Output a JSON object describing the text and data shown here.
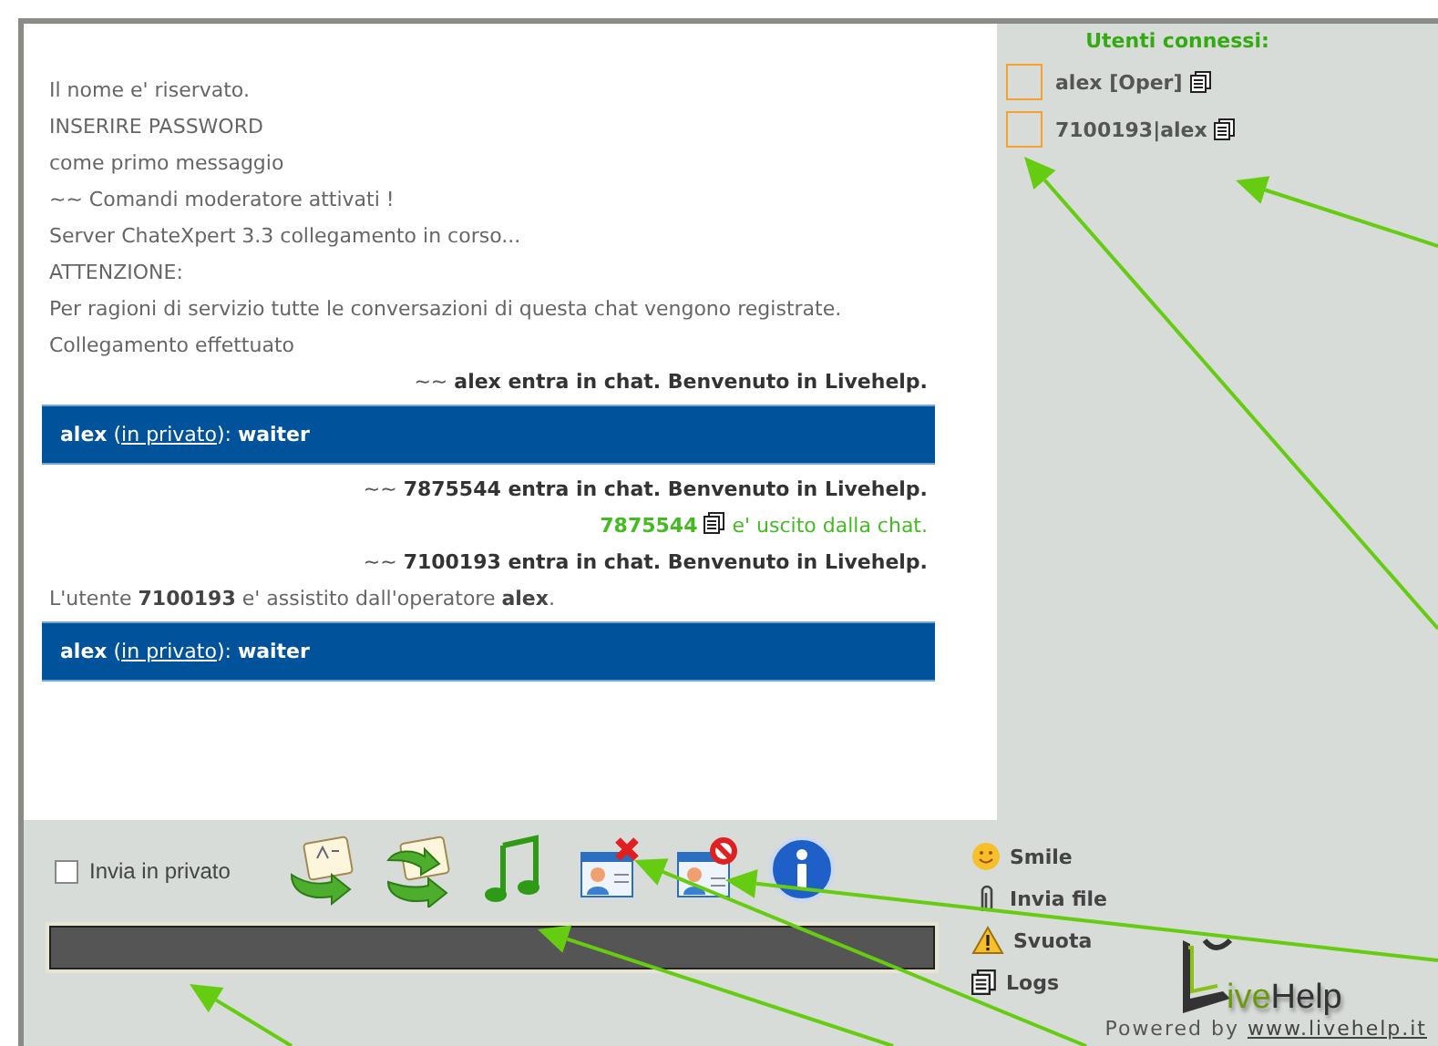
{
  "chat": {
    "messages": [
      {
        "kind": "system",
        "text": "Il nome e' riservato."
      },
      {
        "kind": "system",
        "text": "INSERIRE PASSWORD"
      },
      {
        "kind": "system",
        "text": "come primo messaggio"
      },
      {
        "kind": "system",
        "text": "~~ Comandi moderatore attivati !"
      },
      {
        "kind": "system",
        "text": "Server ChateXpert 3.3 collegamento in corso..."
      },
      {
        "kind": "system",
        "text": "ATTENZIONE:"
      },
      {
        "kind": "system",
        "text": "Per ragioni di servizio tutte le conversazioni di questa chat vengono registrate."
      },
      {
        "kind": "system",
        "text": "Collegamento effettuato"
      },
      {
        "kind": "join",
        "text": "~~ **alex entra in chat. Benvenuto in Livehelp.**"
      },
      {
        "kind": "private",
        "sender": "alex",
        "open": "(",
        "link": "in privato",
        "close": "):",
        "text": "waiter"
      },
      {
        "kind": "join",
        "text": "~~ **7875544 entra in chat. Benvenuto in Livehelp.**"
      },
      {
        "kind": "leave",
        "nick": "7875544",
        "text": "e' uscito dalla chat."
      },
      {
        "kind": "join",
        "text": "~~ **7100193 entra in chat. Benvenuto in Livehelp.**"
      },
      {
        "kind": "system",
        "text": "L'utente **7100193** e' assistito dall'operatore **alex**."
      },
      {
        "kind": "private",
        "sender": "alex",
        "open": "(",
        "link": "in privato",
        "close": "):",
        "text": "waiter"
      }
    ]
  },
  "users": {
    "title": "Utenti connessi:",
    "items": [
      {
        "name": "alex [Oper]"
      },
      {
        "name": "7100193|alex"
      }
    ]
  },
  "composer": {
    "private_checkbox": {
      "label": "Invia in privato",
      "checked": false
    },
    "menu": [
      {
        "kind": "smile",
        "label": "Smile"
      },
      {
        "kind": "attach",
        "label": "Invia file"
      },
      {
        "kind": "clear",
        "label": "Svuota"
      },
      {
        "kind": "logs",
        "label": "Logs"
      }
    ],
    "logo": {
      "accent": "ive",
      "rest": "Help"
    },
    "footer": {
      "text": "Powered by",
      "link": "www.livehelp.it"
    }
  }
}
